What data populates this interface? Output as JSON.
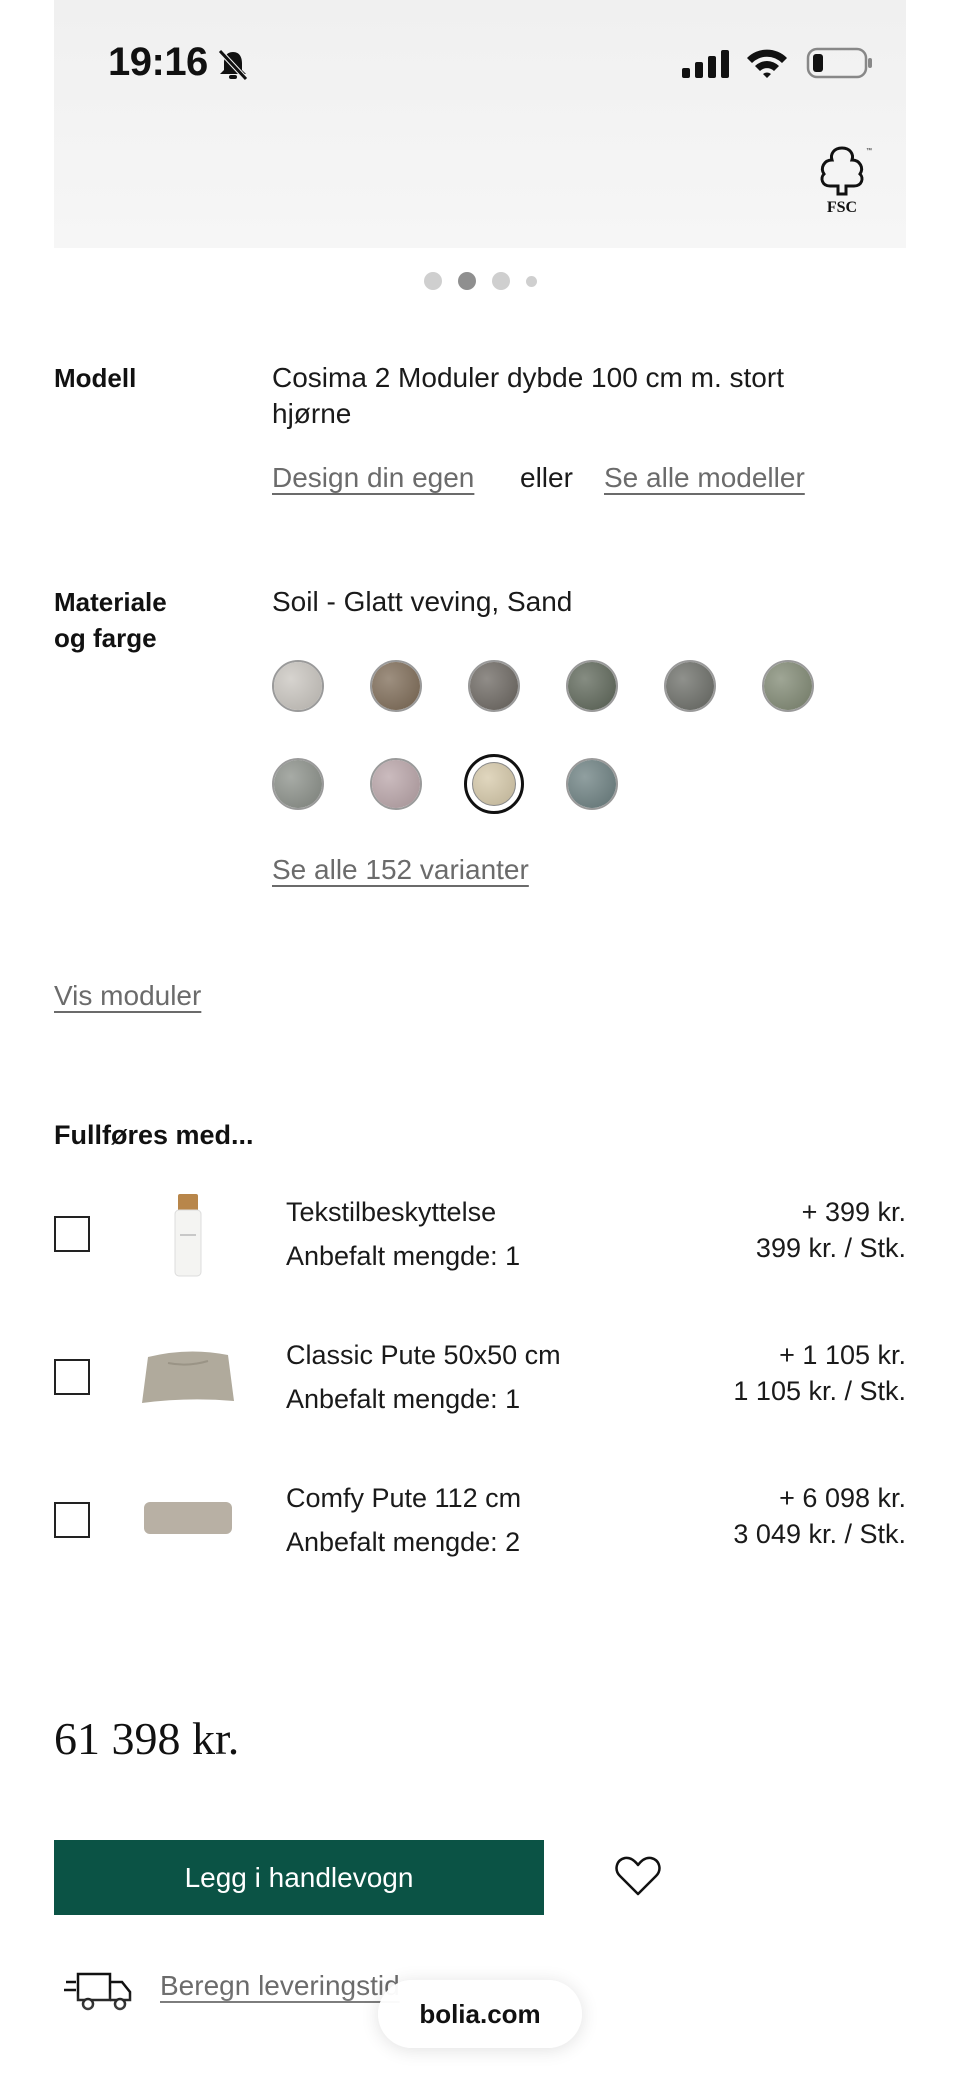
{
  "status_bar": {
    "time": "19:16",
    "icons": [
      "bell-slash-icon",
      "cellular-signal-icon",
      "wifi-icon",
      "battery-icon"
    ]
  },
  "hero": {
    "logo_text": "FSC",
    "carousel_dots": 4,
    "active_dot": 2
  },
  "model": {
    "label": "Modell",
    "line1": "Cosima 2 Moduler dybde 100 cm m. stort",
    "line2": "hjørne",
    "design_link": "Design din egen",
    "or_text": "eller",
    "all_models_link": "Se alle modeller"
  },
  "material": {
    "label_line1": "Materiale",
    "label_line2": "og farge",
    "selected": "Soil - Glatt veving, Sand",
    "swatches": [
      "#c9c5bf",
      "#7d6a55",
      "#6b6660",
      "#5d6658",
      "#6a6c66",
      "#7f8872",
      "#8a8f88",
      "#b9a4a8",
      "#d6c9a9",
      "#6b7f80"
    ],
    "selected_index": 8,
    "all_variants_link": "Se alle 152 varianter"
  },
  "modules_link": "Vis moduler",
  "addons": {
    "title": "Fullføres med...",
    "items": [
      {
        "name": "Tekstilbeskyttelse",
        "qty": "Anbefalt mengde: 1",
        "price": "+ 399 kr.",
        "unit": "399 kr. / Stk.",
        "icon": "spray-bottle-image"
      },
      {
        "name": "Classic Pute 50x50 cm",
        "qty": "Anbefalt mengde: 1",
        "price": "+ 1 105 kr.",
        "unit": "1 105 kr. / Stk.",
        "icon": "cushion-image"
      },
      {
        "name": "Comfy Pute 112 cm",
        "qty": "Anbefalt mengde: 2",
        "price": "+ 6 098 kr.",
        "unit": "3 049 kr. / Stk.",
        "icon": "long-cushion-image"
      }
    ]
  },
  "total": "61 398 kr.",
  "actions": {
    "add_to_cart": "Legg i handlevogn",
    "brand_color": "#0b5345"
  },
  "delivery": {
    "link": "Beregn leveringstid"
  },
  "browser": {
    "url": "bolia.com"
  }
}
